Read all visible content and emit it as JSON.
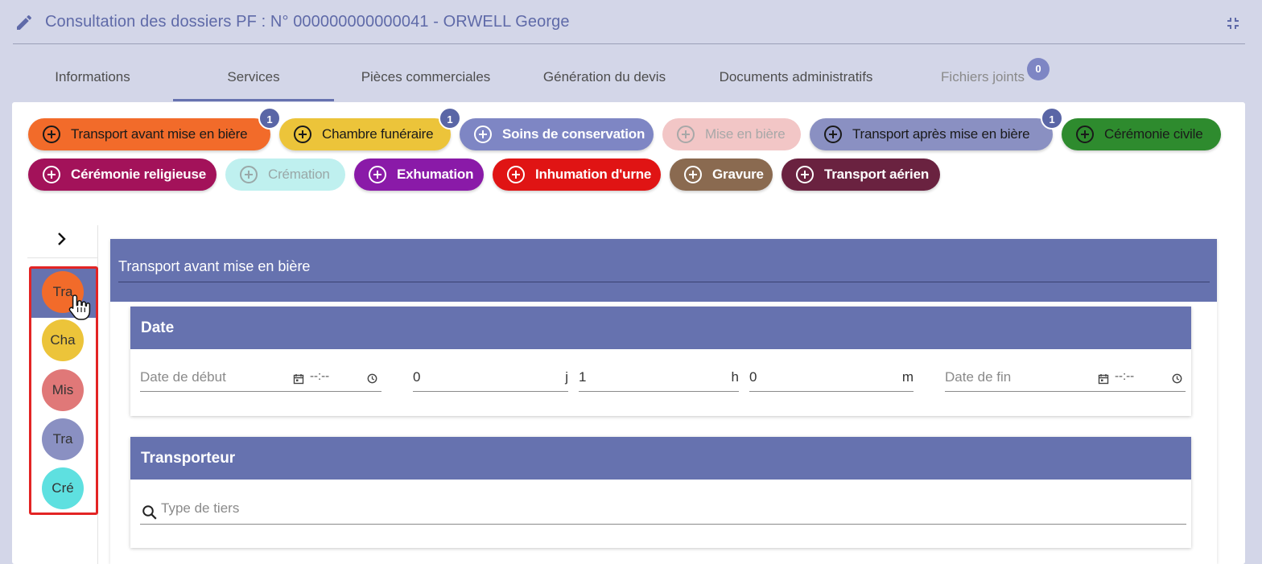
{
  "header": {
    "title": "Consultation des dossiers PF : N° 000000000000041 - ORWELL George",
    "edit_icon": "pencil-icon",
    "collapse_icon": "fullscreen-exit-icon",
    "title_color": "#5f6aa8"
  },
  "tabs": [
    {
      "label": "Informations"
    },
    {
      "label": "Services"
    },
    {
      "label": "Pièces commerciales"
    },
    {
      "label": "Génération du devis"
    },
    {
      "label": "Documents administratifs"
    },
    {
      "label": "Fichiers joints",
      "badge": "0"
    }
  ],
  "active_tab": "Services",
  "services": [
    {
      "label": "Transport avant mise en bière",
      "badge": "1",
      "color": "#f26b2a"
    },
    {
      "label": "Chambre funéraire",
      "badge": "1",
      "color": "#ecc43a"
    },
    {
      "label": "Soins de conservation",
      "color": "#7e86c4"
    },
    {
      "label": "Mise en bière",
      "color": "#f2c6c6"
    },
    {
      "label": "Transport après mise en bière",
      "badge": "1",
      "color": "#8a90c2"
    },
    {
      "label": "Cérémonie civile",
      "color": "#2e8b2e"
    },
    {
      "label": "Cérémonie religieuse",
      "color": "#a3125a"
    },
    {
      "label": "Crémation",
      "color": "#bff0ef"
    },
    {
      "label": "Exhumation",
      "color": "#8a1aa8"
    },
    {
      "label": "Inhumation d'urne",
      "color": "#e01414"
    },
    {
      "label": "Gravure",
      "color": "#8a6a50"
    },
    {
      "label": "Transport aérien",
      "color": "#6a2240"
    }
  ],
  "sidebar": {
    "expand_icon": "chevron-right-icon",
    "items": [
      {
        "abbr": "Tra",
        "color": "#f26b2a"
      },
      {
        "abbr": "Cha",
        "color": "#ecc43a"
      },
      {
        "abbr": "Mis",
        "color": "#e07878"
      },
      {
        "abbr": "Tra",
        "color": "#8a90c2"
      },
      {
        "abbr": "Cré",
        "color": "#5ee0e0"
      }
    ]
  },
  "section": {
    "title": "Transport avant mise en bière",
    "date_card": {
      "title": "Date",
      "start_placeholder": "Date de début",
      "start_time": "--:--",
      "days_value": "0",
      "days_unit": "j",
      "hours_value": "1",
      "hours_unit": "h",
      "minutes_value": "0",
      "minutes_unit": "m",
      "end_placeholder": "Date de fin",
      "end_time": "--:--"
    },
    "transporteur_card": {
      "title": "Transporteur",
      "search_placeholder": "Type de tiers"
    }
  }
}
